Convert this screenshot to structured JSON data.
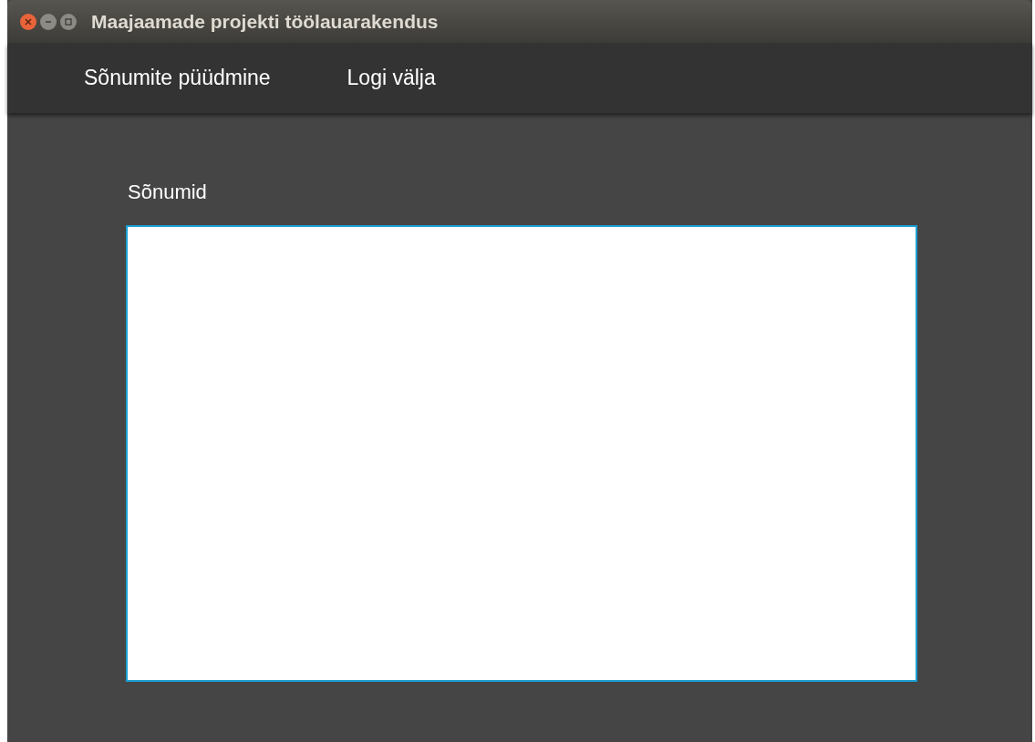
{
  "window": {
    "title": "Maajaamade projekti töölauarakendus"
  },
  "menu": [
    {
      "label": "Sõnumite püüdmine"
    },
    {
      "label": "Logi välja"
    }
  ],
  "messages": {
    "label": "Sõnumid"
  }
}
